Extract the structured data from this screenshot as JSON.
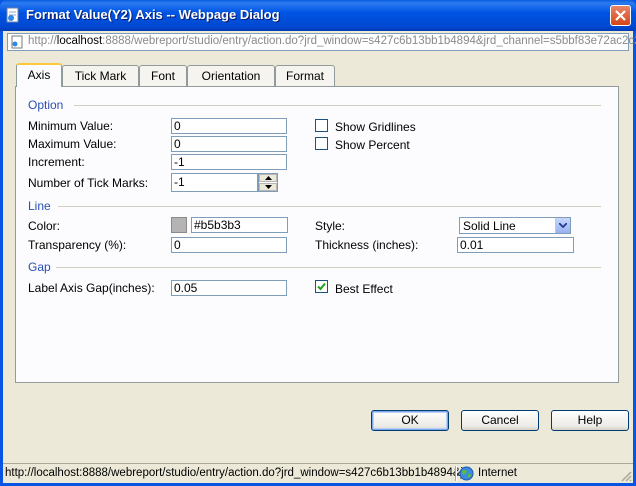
{
  "window": {
    "title": "Format Value(Y2) Axis -- Webpage Dialog",
    "address_prefix": "http://",
    "address_host": "localhost",
    "address_rest": ":8888/webreport/studio/entry/action.do?jrd_window=s427c6b13bb1b4894&jrd_channel=s5bbf83e72ac2c28"
  },
  "tabs": [
    {
      "label": "Axis",
      "active": true
    },
    {
      "label": "Tick Mark"
    },
    {
      "label": "Font"
    },
    {
      "label": "Orientation"
    },
    {
      "label": "Format"
    }
  ],
  "option": {
    "title": "Option",
    "min_label": "Minimum Value:",
    "min_value": "0",
    "max_label": "Maximum Value:",
    "max_value": "0",
    "inc_label": "Increment:",
    "inc_value": "-1",
    "ticks_label": "Number of Tick Marks:",
    "ticks_value": "-1",
    "gridlines_label": "Show Gridlines",
    "gridlines_checked": false,
    "percent_label": "Show Percent",
    "percent_checked": false
  },
  "line": {
    "title": "Line",
    "color_label": "Color:",
    "color_value": "#b5b3b3",
    "color_swatch": "#b5b3b3",
    "style_label": "Style:",
    "style_value": "Solid Line",
    "transparency_label": "Transparency (%):",
    "transparency_value": "0",
    "thickness_label": "Thickness (inches):",
    "thickness_value": "0.01"
  },
  "gap": {
    "title": "Gap",
    "label_gap_label": "Label Axis Gap(inches):",
    "label_gap_value": "0.05",
    "best_effect_label": "Best Effect",
    "best_effect_checked": true
  },
  "buttons": {
    "ok": "OK",
    "cancel": "Cancel",
    "help": "Help"
  },
  "status": {
    "url": "http://localhost:8888/webreport/studio/entry/action.do?jrd_window=s427c6b13bb1b4894&jr",
    "zone": "Internet"
  },
  "icons": {
    "title": "ie-page-icon",
    "address": "page-icon",
    "zone": "globe-icon",
    "close": "close-icon",
    "dropdown": "chevron-down-icon"
  }
}
